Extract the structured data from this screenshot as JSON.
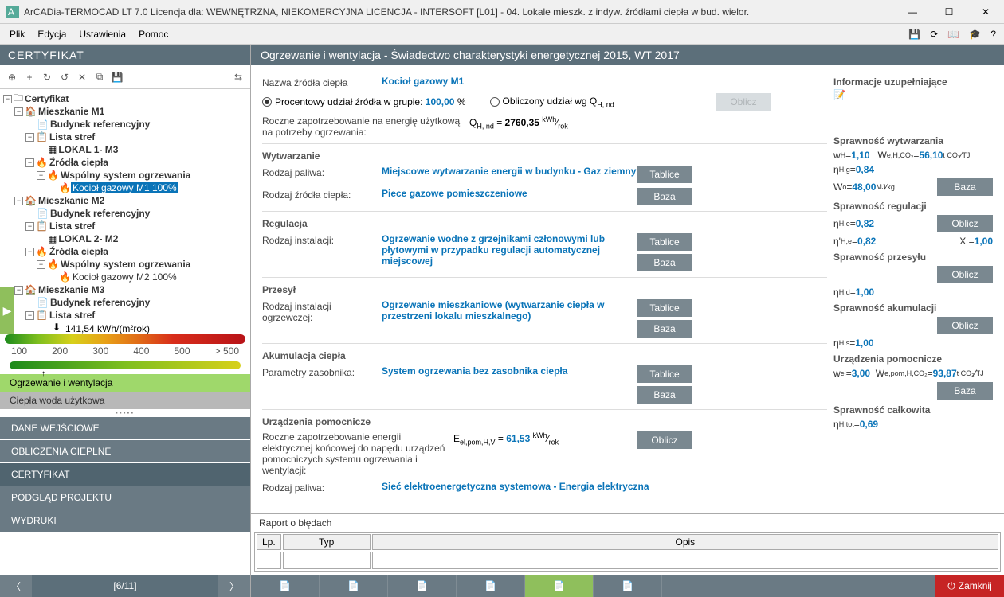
{
  "title": "ArCADia-TERMOCAD LT 7.0 Licencja dla: WEWNĘTRZNA, NIEKOMERCYJNA LICENCJA - INTERSOFT [L01] - 04. Lokale mieszk. z indyw. źródłami ciepła w bud. wielor.",
  "menus": [
    "Plik",
    "Edycja",
    "Ustawienia",
    "Pomoc"
  ],
  "left_section": "CERTYFIKAT",
  "tree": {
    "root": "Certyfikat",
    "m1": "Mieszkanie M1",
    "bud_ref": "Budynek referencyjny",
    "lista_stref": "Lista stref",
    "lokal1": "LOKAL 1- M3",
    "zrodla": "Źródła ciepła",
    "wsp": "Wspólny system ogrzewania",
    "kociol1": "Kocioł gazowy M1 100%",
    "m2": "Mieszkanie M2",
    "lokal2": "LOKAL 2- M2",
    "kociol2": "Kocioł gazowy M2 100%",
    "m3": "Mieszkanie M3"
  },
  "gauge_value": "141,54 kWh/(m²rok)",
  "gauge_ticks": [
    "100",
    "200",
    "300",
    "400",
    "500",
    "> 500"
  ],
  "sel_list": {
    "active": "Ogrzewanie i wentylacja",
    "inactive": "Ciepła woda użytkowa"
  },
  "nav": [
    "DANE WEJŚCIOWE",
    "OBLICZENIA CIEPLNE",
    "CERTYFIKAT",
    "PODGLĄD PROJEKTU",
    "WYDRUKI"
  ],
  "pager": "[6/11]",
  "content_title": "Ogrzewanie i wentylacja - Świadectwo charakterystyki energetycznej 2015, WT 2017",
  "fields": {
    "nazwa_l": "Nazwa źródła ciepła",
    "nazwa_v": "Kocioł gazowy M1",
    "radio1": "Procentowy udział źródła w grupie:",
    "radio1_v": "100,00",
    "radio1_u": "%",
    "radio2": "Obliczony udział wg Q",
    "oblicz": "Oblicz",
    "roczne": "Roczne zapotrzebowanie na energię użytkową na potrzeby ogrzewania:",
    "qh": "2760,35",
    "wytw": "Wytwarzanie",
    "paliwo_l": "Rodzaj paliwa:",
    "paliwo_v": "Miejscowe wytwarzanie energii w budynku - Gaz ziemny",
    "tablice": "Tablice",
    "rzc_l": "Rodzaj źródła ciepła:",
    "rzc_v": "Piece gazowe pomieszczeniowe",
    "baza": "Baza",
    "reg": "Regulacja",
    "inst_l": "Rodzaj instalacji:",
    "inst_v": "Ogrzewanie wodne z grzejnikami członowymi lub płytowymi w przypadku regulacji automatycznej miejscowej",
    "prz": "Przesył",
    "instog_l": "Rodzaj instalacji ogrzewczej:",
    "instog_v": "Ogrzewanie mieszkaniowe (wytwarzanie ciepła w przestrzeni lokalu mieszkalnego)",
    "akum": "Akumulacja ciepła",
    "param_l": "Parametry zasobnika:",
    "param_v": "System ogrzewania bez zasobnika ciepła",
    "urz": "Urządzenia pomocnicze",
    "urz_txt": "Roczne zapotrzebowanie energii elektrycznej końcowej do napędu urządzeń pomocniczych systemu ogrzewania i wentylacji:",
    "eel": "61,53",
    "paliwo2_v": "Sieć elektroenergetyczna systemowa - Energia elektryczna"
  },
  "side": {
    "info": "Informacje uzupełniające",
    "spr_wytw": "Sprawność wytwarzania",
    "wh": "1,10",
    "we": "56,10",
    "nhg": "0,84",
    "wo": "48,00",
    "spr_reg": "Sprawność regulacji",
    "nhe": "0,82",
    "nhe2": "0,82",
    "x": "1,00",
    "spr_prz": "Sprawność przesyłu",
    "nhd": "1,00",
    "spr_ak": "Sprawność akumulacji",
    "nhs": "1,00",
    "urz_pom": "Urządzenia pomocnicze",
    "wel": "3,00",
    "wep": "93,87",
    "spr_cal": "Sprawność całkowita",
    "ntot": "0,69"
  },
  "report": {
    "title": "Raport o błędach",
    "cols": [
      "Lp.",
      "Typ",
      "Opis"
    ]
  },
  "close": "Zamknij"
}
